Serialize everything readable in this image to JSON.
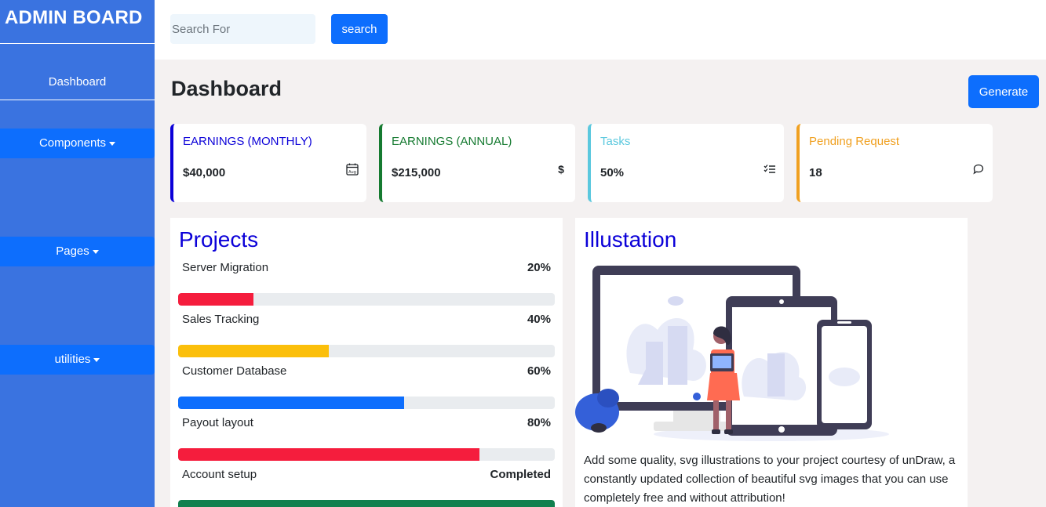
{
  "sidebar": {
    "brand": "ADMIN BOARD",
    "dashboard": "Dashboard",
    "items": [
      {
        "label": "Components"
      },
      {
        "label": "Pages"
      },
      {
        "label": "utilities"
      }
    ]
  },
  "topbar": {
    "search_placeholder": "Search For",
    "search_button": "search"
  },
  "header": {
    "title": "Dashboard",
    "generate_button": "Generate"
  },
  "cards": [
    {
      "label": "EARNINGS (MONTHLY)",
      "value": "$40,000",
      "icon": "calendar-icon",
      "color": "#0b00d8"
    },
    {
      "label": "EARNINGS (ANNUAL)",
      "value": "$215,000",
      "icon": "dollar-icon",
      "color": "#157a30"
    },
    {
      "label": "Tasks",
      "value": "50%",
      "icon": "checklist-icon",
      "color": "#5bc8de"
    },
    {
      "label": "Pending Request",
      "value": "18",
      "icon": "chat-icon",
      "color": "#f0a020"
    }
  ],
  "projects": {
    "title": "Projects",
    "items": [
      {
        "name": "Server Migration",
        "percent_label": "20%",
        "progress": 0.2,
        "color": "#f51d3d"
      },
      {
        "name": "Sales Tracking",
        "percent_label": "40%",
        "progress": 0.4,
        "color": "#fbbf0b"
      },
      {
        "name": "Customer Database",
        "percent_label": "60%",
        "progress": 0.6,
        "color": "#0d6efd"
      },
      {
        "name": "Payout layout",
        "percent_label": "80%",
        "progress": 0.8,
        "color": "#f51d3d"
      },
      {
        "name": "Account setup",
        "percent_label": "Completed",
        "progress": 1.0,
        "color": "#11804f"
      }
    ]
  },
  "illustration": {
    "title": "Illustation",
    "text": "Add some quality, svg illustrations to your project courtesy of unDraw, a constantly updated collection of beautiful svg images that you can use completely free and without attribution!"
  }
}
